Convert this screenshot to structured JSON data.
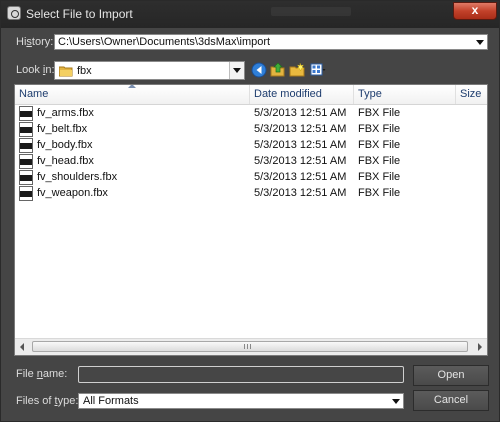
{
  "window": {
    "title": "Select File to Import",
    "close_glyph": "x"
  },
  "history": {
    "label_pre": "Hi",
    "label_key": "s",
    "label_post": "tory:",
    "value": "C:\\Users\\Owner\\Documents\\3dsMax\\import"
  },
  "lookin": {
    "label_pre": "Look ",
    "label_key": "i",
    "label_post": "n:",
    "value": "fbx"
  },
  "toolbar": {
    "icons": [
      "back-icon",
      "up-folder-icon",
      "new-folder-icon",
      "view-menu-icon"
    ]
  },
  "list": {
    "columns": [
      "Name",
      "Date modified",
      "Type",
      "Size"
    ],
    "rows": [
      {
        "name": "fv_arms.fbx",
        "date": "5/3/2013 12:51 AM",
        "type": "FBX File"
      },
      {
        "name": "fv_belt.fbx",
        "date": "5/3/2013 12:51 AM",
        "type": "FBX File"
      },
      {
        "name": "fv_body.fbx",
        "date": "5/3/2013 12:51 AM",
        "type": "FBX File"
      },
      {
        "name": "fv_head.fbx",
        "date": "5/3/2013 12:51 AM",
        "type": "FBX File"
      },
      {
        "name": "fv_shoulders.fbx",
        "date": "5/3/2013 12:51 AM",
        "type": "FBX File"
      },
      {
        "name": "fv_weapon.fbx",
        "date": "5/3/2013 12:51 AM",
        "type": "FBX File"
      }
    ]
  },
  "filename": {
    "label_pre": "File ",
    "label_key": "n",
    "label_post": "ame:",
    "value": ""
  },
  "filetype": {
    "label_pre": "Files of ",
    "label_key": "t",
    "label_post": "ype:",
    "value": "All Formats"
  },
  "buttons": {
    "open": "Open",
    "cancel": "Cancel"
  },
  "colors": {
    "dialog_bg": "#454545",
    "titlebar_bg": "#2b2b2b",
    "close_button": "#c2412a",
    "column_header_text": "#1e3d6e"
  }
}
